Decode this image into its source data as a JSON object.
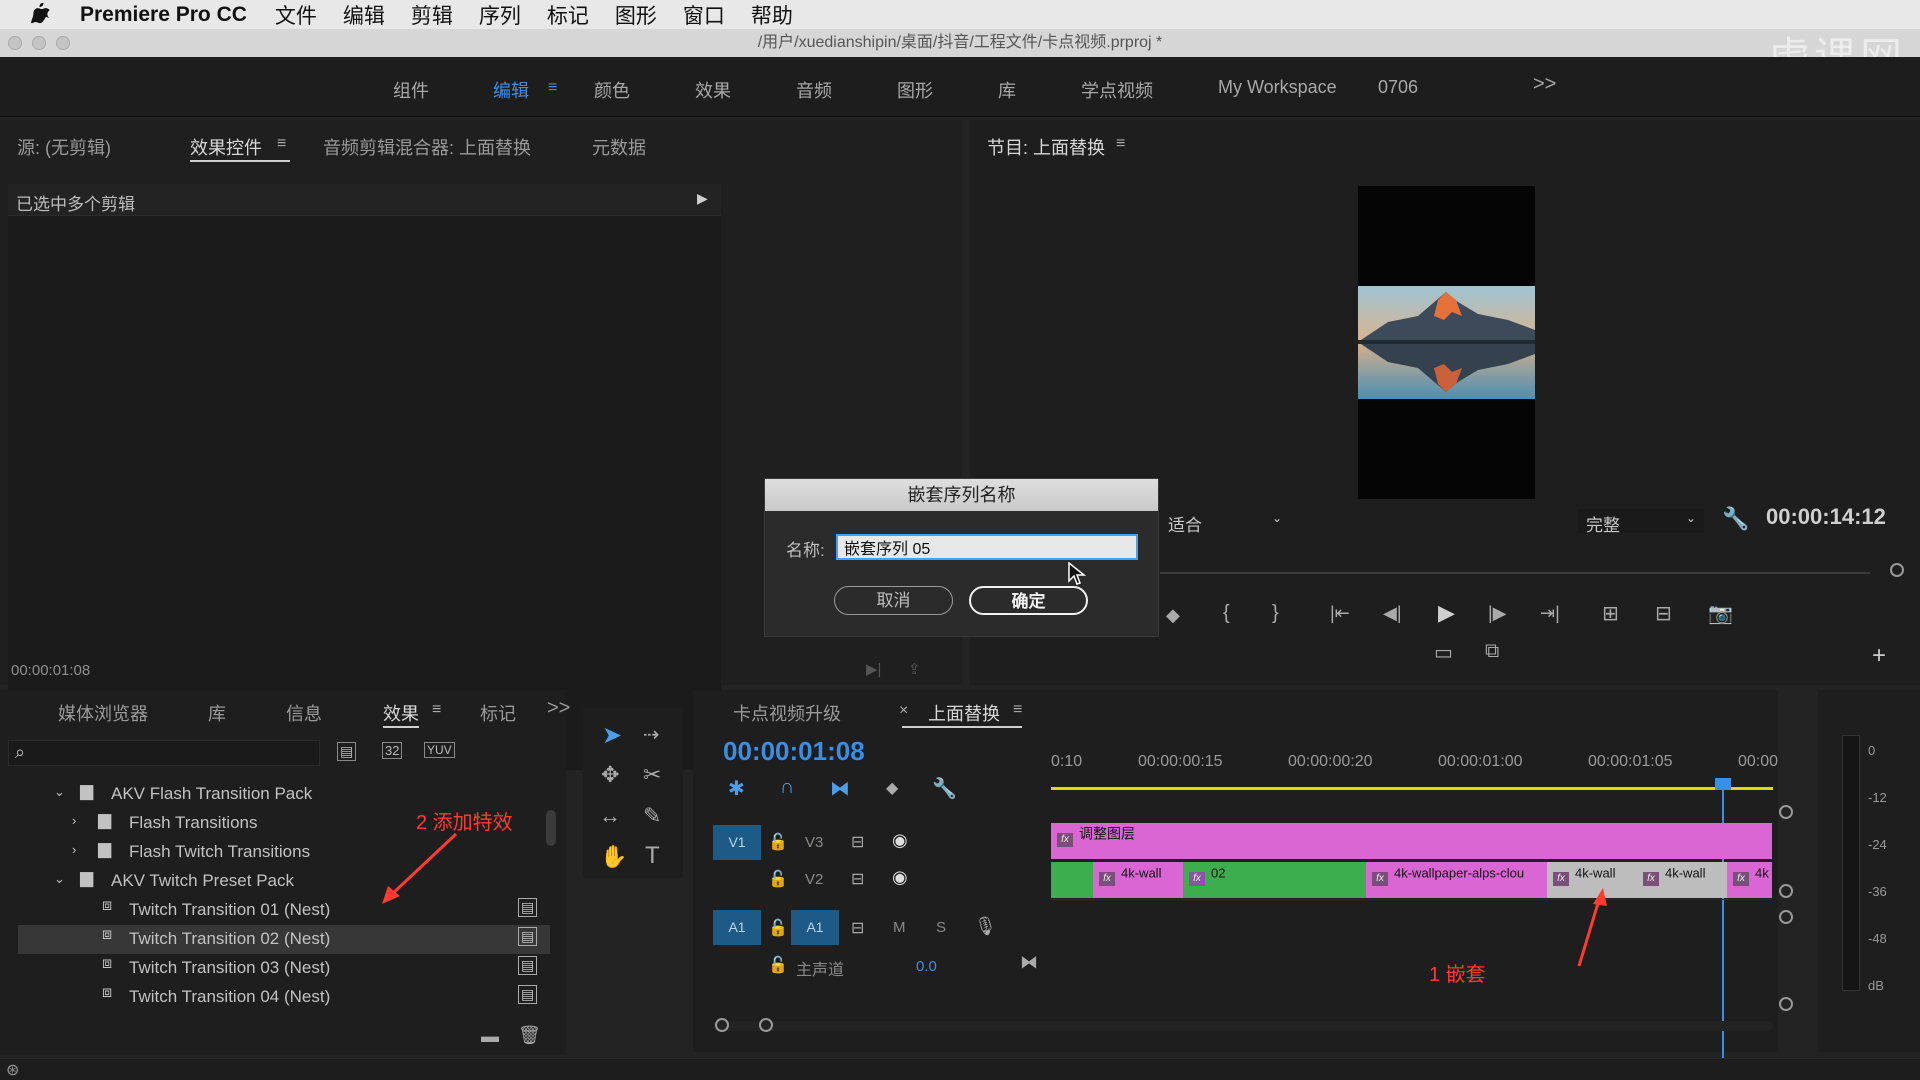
{
  "menubar": {
    "app_name": "Premiere Pro CC",
    "items": [
      "文件",
      "编辑",
      "剪辑",
      "序列",
      "标记",
      "图形",
      "窗口",
      "帮助"
    ]
  },
  "titlebar": {
    "path": "/用户/xuedianshipin/桌面/抖音/工程文件/卡点视频.prproj *"
  },
  "watermark": "虎课网",
  "workspaces": {
    "items": [
      "组件",
      "编辑",
      "颜色",
      "效果",
      "音频",
      "图形",
      "库",
      "学点视频",
      "My Workspace",
      "0706"
    ],
    "active": "编辑",
    "overflow": ">>"
  },
  "source_panel": {
    "tabs": [
      "源: (无剪辑)",
      "效果控件",
      "音频剪辑混合器: 上面替换",
      "元数据"
    ],
    "active_tab": "效果控件",
    "selection_label": "已选中多个剪辑",
    "timecode": "00:00:01:08"
  },
  "program_panel": {
    "title": "节目: 上面替换",
    "fit_select": "适合",
    "quality_select": "完整",
    "timecode": "00:00:14:12"
  },
  "dialog": {
    "title": "嵌套序列名称",
    "name_label": "名称:",
    "name_value": "嵌套序列 05",
    "cancel_label": "取消",
    "ok_label": "确定"
  },
  "effects_panel": {
    "tabs": [
      "媒体浏览器",
      "库",
      "信息",
      "效果",
      "标记"
    ],
    "active_tab": "效果",
    "overflow": ">>",
    "tree": [
      {
        "label": "AKV Flash Transition Pack",
        "level": 0,
        "expanded": true
      },
      {
        "label": "Flash Transitions",
        "level": 1,
        "expanded": false
      },
      {
        "label": "Flash Twitch Transitions",
        "level": 1,
        "expanded": false
      },
      {
        "label": "AKV Twitch Preset Pack",
        "level": 0,
        "expanded": true
      },
      {
        "label": "Twitch Transition 01 (Nest)",
        "level": 2
      },
      {
        "label": "Twitch Transition 02 (Nest)",
        "level": 2,
        "selected": true
      },
      {
        "label": "Twitch Transition 03 (Nest)",
        "level": 2
      },
      {
        "label": "Twitch Transition 04 (Nest)",
        "level": 2
      }
    ],
    "annotation": "2 添加特效"
  },
  "timeline": {
    "tabs": [
      "卡点视频升级",
      "上面替换"
    ],
    "active_tab": "上面替换",
    "timecode": "00:00:01:08",
    "ruler": [
      "0:10",
      "00:00:00:15",
      "00:00:00:20",
      "00:00:01:00",
      "00:00:01:05",
      "00:00"
    ],
    "tracks": {
      "v1": "V1",
      "v3": "V3",
      "v2": "V2",
      "a1_src": "A1",
      "a1": "A1",
      "m": "M",
      "s": "S",
      "master_label": "主声道",
      "master_value": "0.0"
    },
    "clips": {
      "adjustment": "调整图层",
      "c1": "4k-wall",
      "c2": "02",
      "c3": "4k-wallpaper-alps-clou",
      "c4": "4k-wall",
      "c5": "4k-wall",
      "c6": "4k"
    },
    "annotation": "1 嵌套",
    "colors": {
      "pink": "#d966d3",
      "green": "#3dae4e",
      "gray": "#bdbdbd",
      "accent": "#3a8ee6"
    }
  },
  "meter": {
    "labels": [
      "0",
      "-12",
      "-24",
      "-36",
      "-48",
      "dB"
    ]
  }
}
